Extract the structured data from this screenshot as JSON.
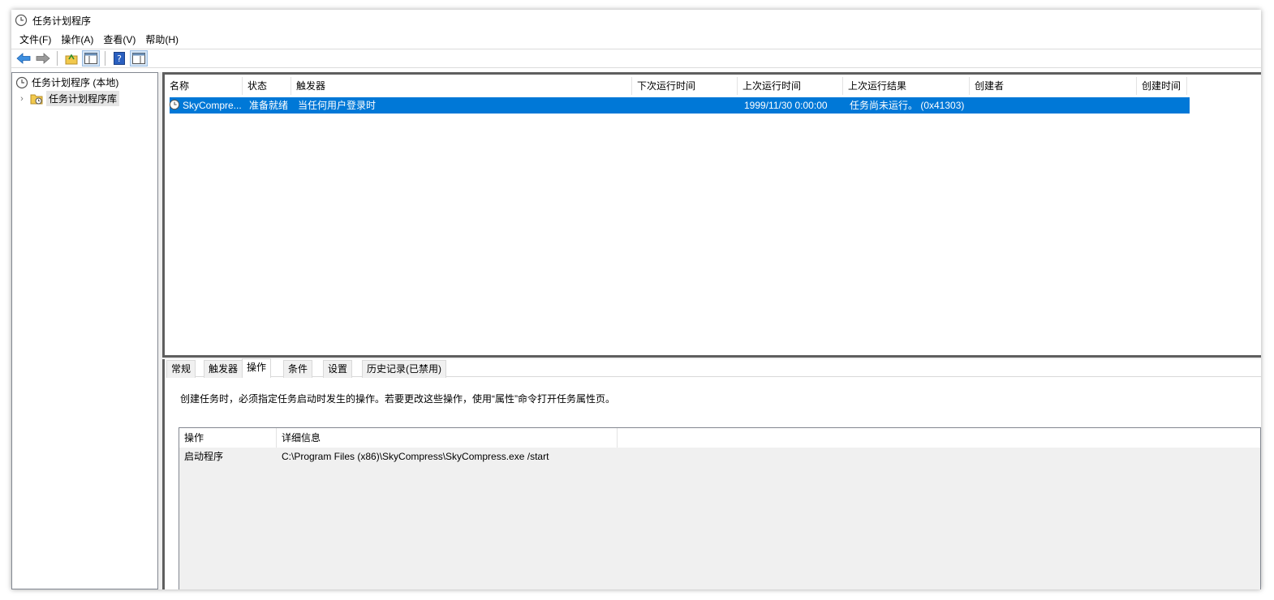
{
  "window": {
    "title": "任务计划程序"
  },
  "menu": [
    "文件(F)",
    "操作(A)",
    "查看(V)",
    "帮助(H)"
  ],
  "toolbar": {
    "buttons": [
      "back-icon",
      "forward-icon",
      "up-folder-icon",
      "show-hide-console-tree-icon",
      "help-icon",
      "show-hide-action-pane-icon"
    ]
  },
  "tree": {
    "root": "任务计划程序 (本地)",
    "child": "任务计划程序库"
  },
  "task_list": {
    "columns": [
      "名称",
      "状态",
      "触发器",
      "下次运行时间",
      "上次运行时间",
      "上次运行结果",
      "创建者",
      "创建时间"
    ],
    "rows": [
      {
        "name": "SkyCompre...",
        "status": "准备就绪",
        "trigger": "当任何用户登录时",
        "next_run": "",
        "last_run": "1999/11/30 0:00:00",
        "last_result": "任务尚未运行。 (0x41303)",
        "author": "",
        "created": ""
      }
    ],
    "selected_color": "#0078d7"
  },
  "detail": {
    "tabs": [
      "常规",
      "触发器",
      "操作",
      "条件",
      "设置",
      "历史记录(已禁用)"
    ],
    "active_tab": "操作",
    "description": "创建任务时，必须指定任务启动时发生的操作。若要更改这些操作，使用“属性”命令打开任务属性页。",
    "actions_table": {
      "columns": [
        "操作",
        "详细信息"
      ],
      "rows": [
        {
          "action": "启动程序",
          "details": "C:\\Program Files (x86)\\SkyCompress\\SkyCompress.exe /start"
        }
      ]
    }
  }
}
